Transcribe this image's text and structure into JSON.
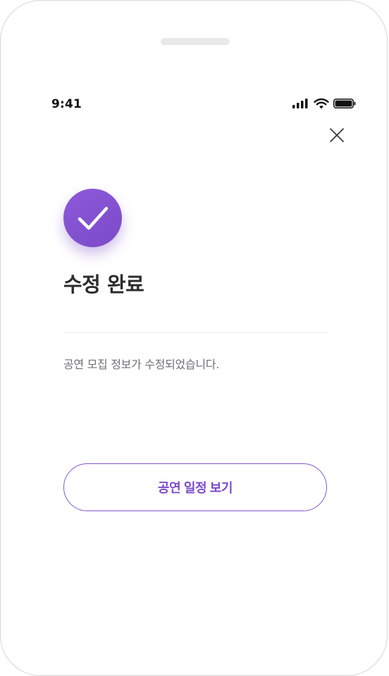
{
  "status_bar": {
    "time": "9:41",
    "icons": [
      "signal-icon",
      "wifi-icon",
      "battery-icon"
    ]
  },
  "header": {
    "close_icon": "close-icon"
  },
  "result": {
    "icon": "check-icon",
    "title": "수정 완료",
    "message": "공연 모집 정보가 수정되었습니다."
  },
  "actions": {
    "primary_label": "공연 일정 보기"
  },
  "colors": {
    "accent": "#7d49cc",
    "title": "#2c2c2c",
    "body_text": "#6f6f73",
    "divider": "#ececec"
  }
}
